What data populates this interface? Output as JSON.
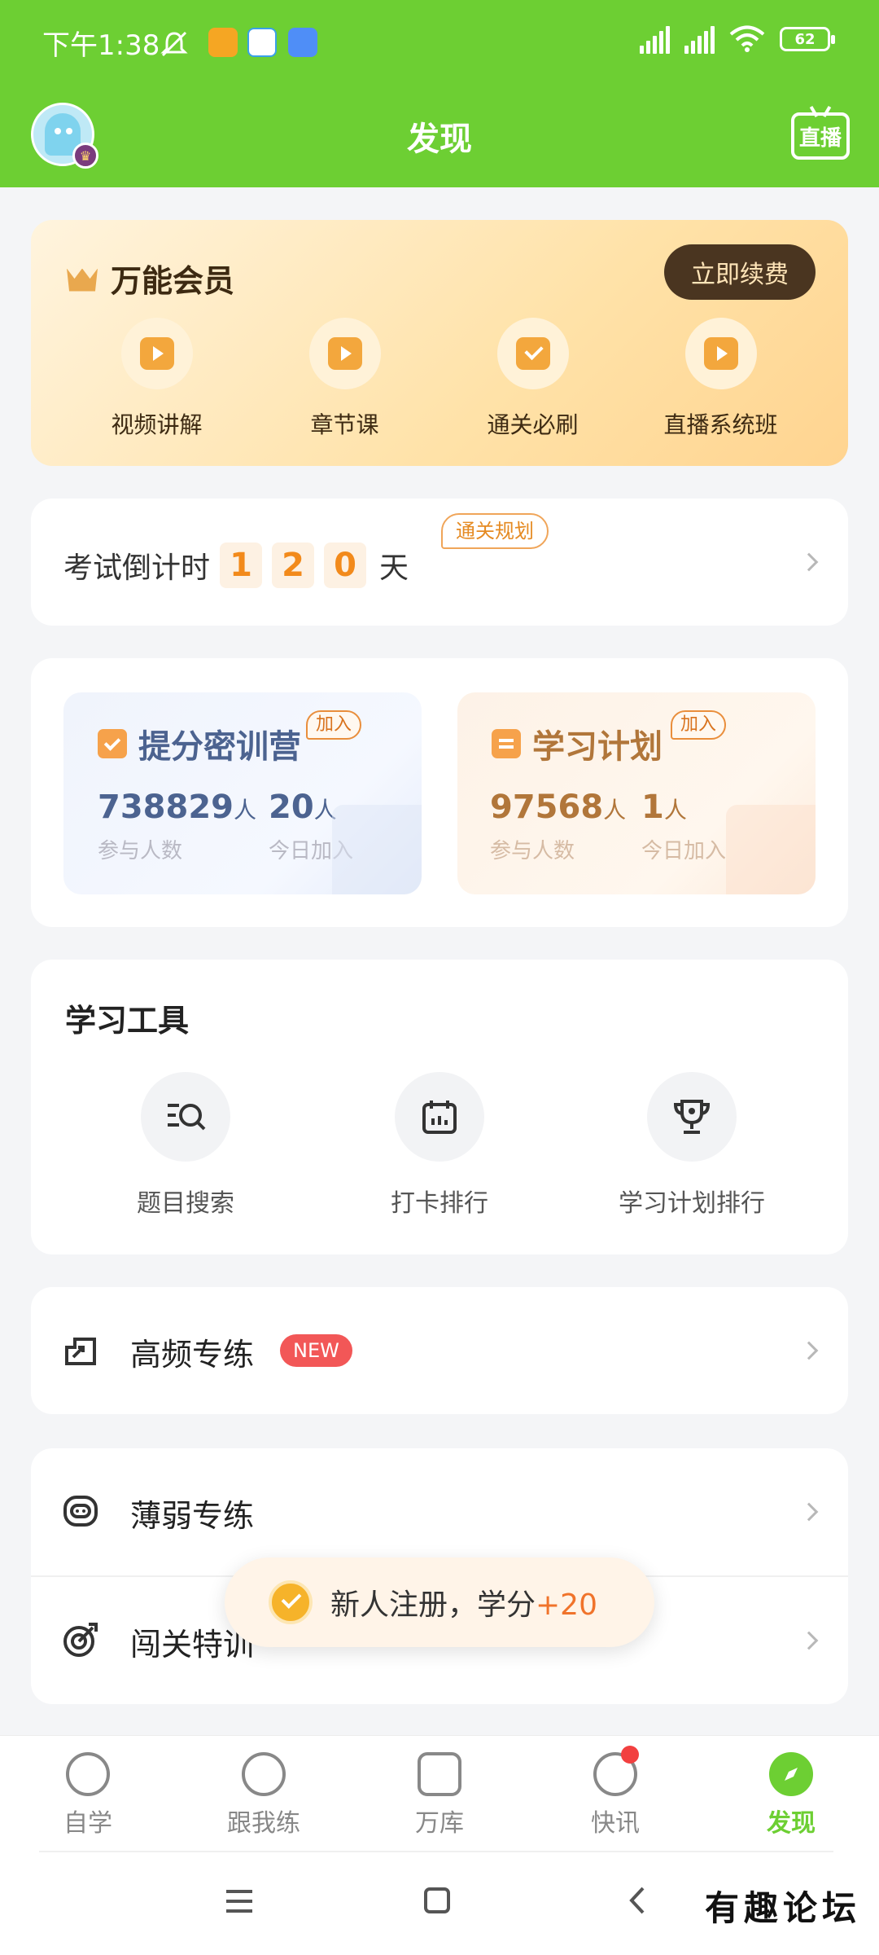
{
  "status_bar": {
    "time": "下午1:38",
    "battery": "62"
  },
  "header": {
    "title": "发现",
    "live_label": "直播"
  },
  "vip": {
    "title": "万能会员",
    "renew_label": "立即续费",
    "items": [
      {
        "label": "视频讲解",
        "icon": "video-icon"
      },
      {
        "label": "章节课",
        "icon": "chapter-course-icon"
      },
      {
        "label": "通关必刷",
        "icon": "checklist-icon"
      },
      {
        "label": "直播系统班",
        "icon": "live-class-icon"
      }
    ]
  },
  "countdown": {
    "label": "考试倒计时",
    "digits": [
      "1",
      "2",
      "0"
    ],
    "unit": "天",
    "tag": "通关规划"
  },
  "camps": [
    {
      "title": "提分密训营",
      "join_tag": "加入",
      "participants": "738829",
      "participants_unit": "人",
      "participants_label": "参与人数",
      "today": "20",
      "today_unit": "人",
      "today_label": "今日加入"
    },
    {
      "title": "学习计划",
      "join_tag": "加入",
      "participants": "97568",
      "participants_unit": "人",
      "participants_label": "参与人数",
      "today": "1",
      "today_unit": "人",
      "today_label": "今日加入"
    }
  ],
  "tools": {
    "title": "学习工具",
    "items": [
      {
        "label": "题目搜索",
        "icon": "search-list-icon"
      },
      {
        "label": "打卡排行",
        "icon": "calendar-icon"
      },
      {
        "label": "学习计划排行",
        "icon": "trophy-icon"
      }
    ]
  },
  "practice": {
    "high_freq": {
      "label": "高频专练",
      "badge": "NEW"
    },
    "weak": {
      "label": "薄弱专练"
    },
    "challenge": {
      "label": "闯关特训"
    }
  },
  "toast": {
    "text": "新人注册，学分",
    "points": "+20"
  },
  "tabbar": {
    "items": [
      {
        "label": "自学",
        "icon": "self-study-icon"
      },
      {
        "label": "跟我练",
        "icon": "practice-icon"
      },
      {
        "label": "万库",
        "icon": "library-icon"
      },
      {
        "label": "快讯",
        "icon": "flash-news-icon"
      },
      {
        "label": "发现",
        "icon": "compass-icon"
      }
    ],
    "active_index": 4
  },
  "watermark": "有趣论坛",
  "colors": {
    "primary_green": "#6dcf33",
    "accent_orange": "#f28a1b",
    "badge_red": "#f25757"
  }
}
